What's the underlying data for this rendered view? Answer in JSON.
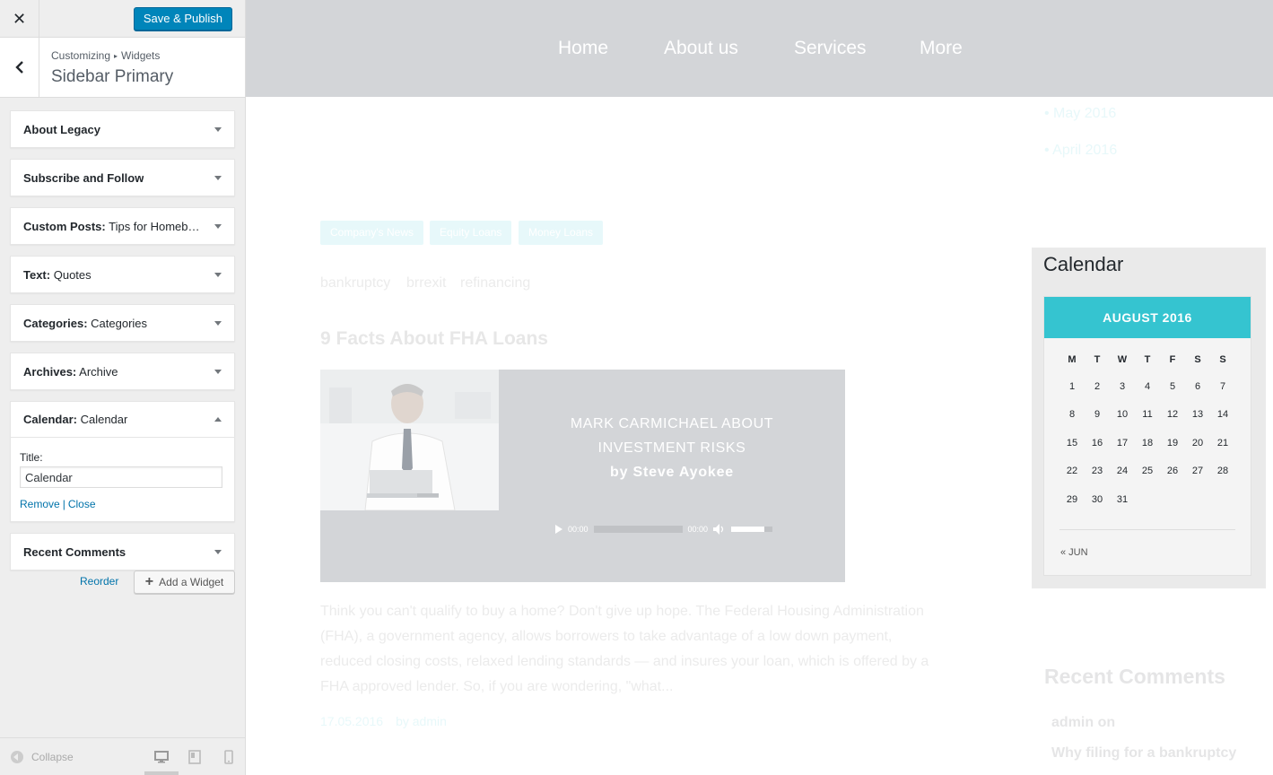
{
  "customizer": {
    "close_label": "✕",
    "save_publish_label": "Save & Publish",
    "breadcrumb": {
      "root": "Customizing",
      "separator": "▸",
      "parent": "Widgets"
    },
    "section_name": "Sidebar Primary",
    "widgets": [
      {
        "name": "About Legacy",
        "subtitle": "",
        "open": false
      },
      {
        "name": "Subscribe and Follow",
        "subtitle": "",
        "open": false
      },
      {
        "name": "Custom Posts:",
        "subtitle": " Tips for Homebuy...",
        "open": false
      },
      {
        "name": "Text:",
        "subtitle": " Quotes",
        "open": false
      },
      {
        "name": "Categories:",
        "subtitle": " Categories",
        "open": false
      },
      {
        "name": "Archives:",
        "subtitle": " Archive",
        "open": false
      },
      {
        "name": "Calendar:",
        "subtitle": " Calendar",
        "open": true
      },
      {
        "name": "Recent Comments",
        "subtitle": "",
        "open": false
      }
    ],
    "calendar_form": {
      "title_label": "Title:",
      "title_value": "Calendar",
      "remove_label": "Remove",
      "separator": "|",
      "close_label": "Close"
    },
    "reorder_label": "Reorder",
    "add_widget_label": "Add a Widget",
    "collapse_label": "Collapse",
    "accent_color": "#0085ba"
  },
  "preview": {
    "nav": [
      "Home",
      "About us",
      "Services",
      "More"
    ],
    "archives": [
      "• May 2016",
      "• April 2016"
    ],
    "post_categories": [
      "Company's News",
      "Equity Loans",
      "Money Loans"
    ],
    "post_tags": [
      "bankruptcy",
      "brrexit",
      "refinancing"
    ],
    "post_title": "9 Facts About FHA Loans",
    "media": {
      "line1": "MARK CARMICHAEL ABOUT",
      "line2": "INVESTMENT RISKS",
      "byline": "by Steve Ayokee",
      "time_current": "00:00",
      "time_total": "00:00",
      "volume_level": 0.8
    },
    "excerpt": "Think you can't qualify to buy a home? Don't give up hope. The Federal Housing Administration (FHA), a government agency, allows borrowers to take advantage of a low down payment, reduced closing costs, relaxed lending standards — and insures your loan, which is offered by a FHA approved lender. So, if you are wondering, \"what...",
    "post_date": "17.05.2016",
    "post_author": "by admin",
    "calendar": {
      "heading": "Calendar",
      "month": "AUGUST 2016",
      "weekdays": [
        "M",
        "T",
        "W",
        "T",
        "F",
        "S",
        "S"
      ],
      "weeks": [
        [
          "1",
          "2",
          "3",
          "4",
          "5",
          "6",
          "7"
        ],
        [
          "8",
          "9",
          "10",
          "11",
          "12",
          "13",
          "14"
        ],
        [
          "15",
          "16",
          "17",
          "18",
          "19",
          "20",
          "21"
        ],
        [
          "22",
          "23",
          "24",
          "25",
          "26",
          "27",
          "28"
        ],
        [
          "29",
          "30",
          "31",
          "",
          "",
          "",
          ""
        ]
      ],
      "prev_link": "« JUN"
    },
    "recent_comments_title": "Recent Comments",
    "comment_lines": [
      "admin on",
      "Why filing for a bankruptcy"
    ],
    "accent_color": "#35c4d0"
  }
}
